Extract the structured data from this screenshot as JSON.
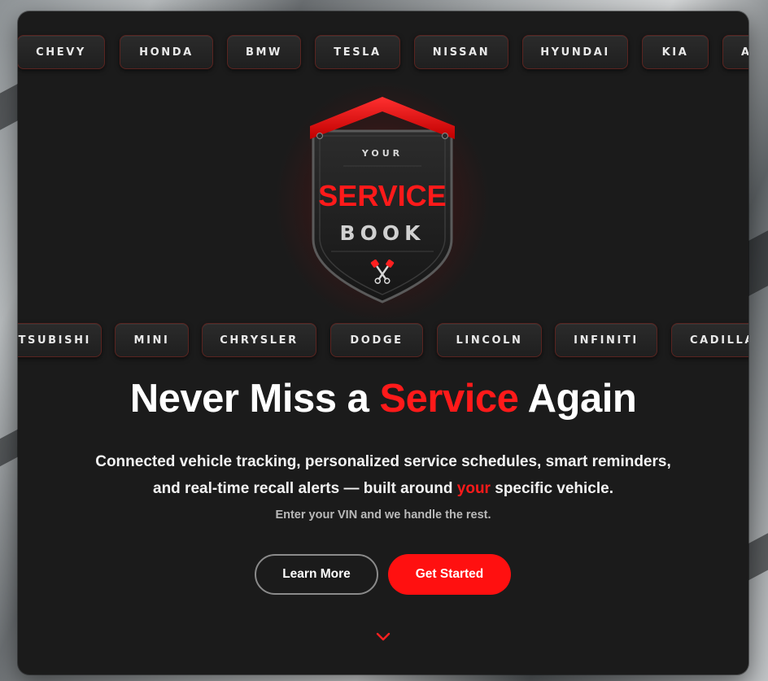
{
  "brands_top": [
    {
      "name": "CHEVY"
    },
    {
      "name": "HONDA"
    },
    {
      "name": "BMW"
    },
    {
      "name": "TESLA"
    },
    {
      "name": "NISSAN"
    },
    {
      "name": "HYUNDAI"
    },
    {
      "name": "KIA"
    },
    {
      "name": "A"
    }
  ],
  "brands_bottom": [
    {
      "name": "TSUBISHI"
    },
    {
      "name": "MINI"
    },
    {
      "name": "CHRYSLER"
    },
    {
      "name": "DODGE"
    },
    {
      "name": "LINCOLN"
    },
    {
      "name": "INFINITI"
    },
    {
      "name": "CADILLA"
    }
  ],
  "logo": {
    "line1": "YOUR",
    "line2": "SERVICE",
    "line3": "BOOK",
    "icon": "pistons-icon"
  },
  "hero": {
    "title_part1": "Never Miss a",
    "title_highlight": "Service",
    "title_part2": "Again",
    "subtitle_part1": "Connected vehicle tracking, personalized service schedules, smart reminders, and real-time recall alerts — built around",
    "subtitle_highlight": "your",
    "subtitle_part2": "specific vehicle.",
    "tagline": "Enter your VIN and we handle the rest."
  },
  "buttons": {
    "learn_more": "Learn More",
    "get_started": "Get Started"
  },
  "scroll_indicator": {
    "icon": "chevron-down-icon"
  },
  "colors": {
    "accent": "#ff1a1a",
    "card_bg": "#1b1b1b",
    "chip_border": "#5a2420",
    "text": "#ffffff"
  }
}
